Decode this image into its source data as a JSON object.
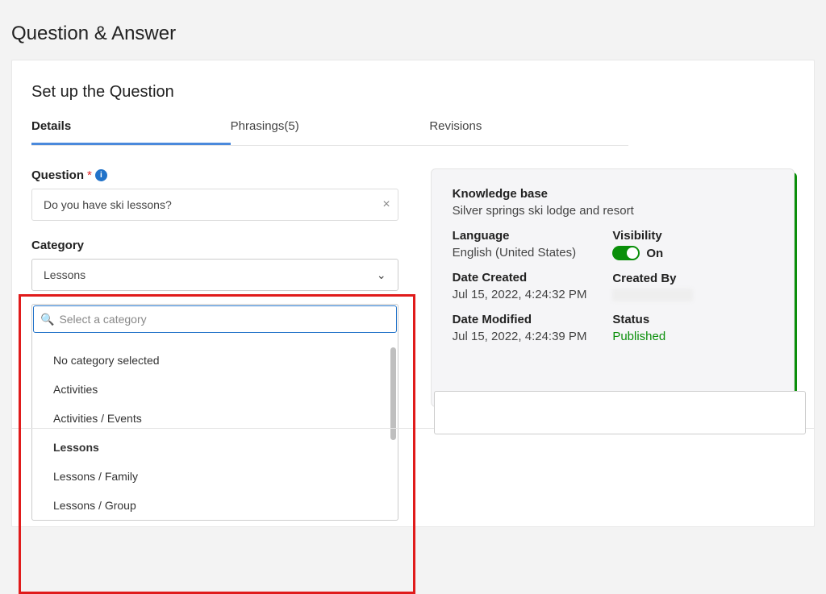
{
  "page_title": "Question & Answer",
  "section_title": "Set up the Question",
  "tabs": {
    "details": "Details",
    "phrasings": "Phrasings(5)",
    "revisions": "Revisions"
  },
  "question": {
    "label": "Question",
    "required_mark": "*",
    "value": "Do you have ski lessons?"
  },
  "category": {
    "label": "Category",
    "selected": "Lessons",
    "search_placeholder": "Select a category",
    "options": [
      {
        "label": "No category selected",
        "bold": false
      },
      {
        "label": "Activities",
        "bold": false
      },
      {
        "label": "Activities / Events",
        "bold": false
      },
      {
        "label": "Lessons",
        "bold": true
      },
      {
        "label": "Lessons / Family",
        "bold": false
      },
      {
        "label": "Lessons / Group",
        "bold": false
      }
    ]
  },
  "side": {
    "kb_label": "Knowledge base",
    "kb_val": "Silver springs ski lodge and resort",
    "lang_label": "Language",
    "lang_val": "English (United States)",
    "created_label": "Date Created",
    "created_val": "Jul 15, 2022, 4:24:32 PM",
    "modified_label": "Date Modified",
    "modified_val": "Jul 15, 2022, 4:24:39 PM",
    "vis_label": "Visibility",
    "vis_val": "On",
    "by_label": "Created By",
    "status_label": "Status",
    "status_val": "Published"
  }
}
